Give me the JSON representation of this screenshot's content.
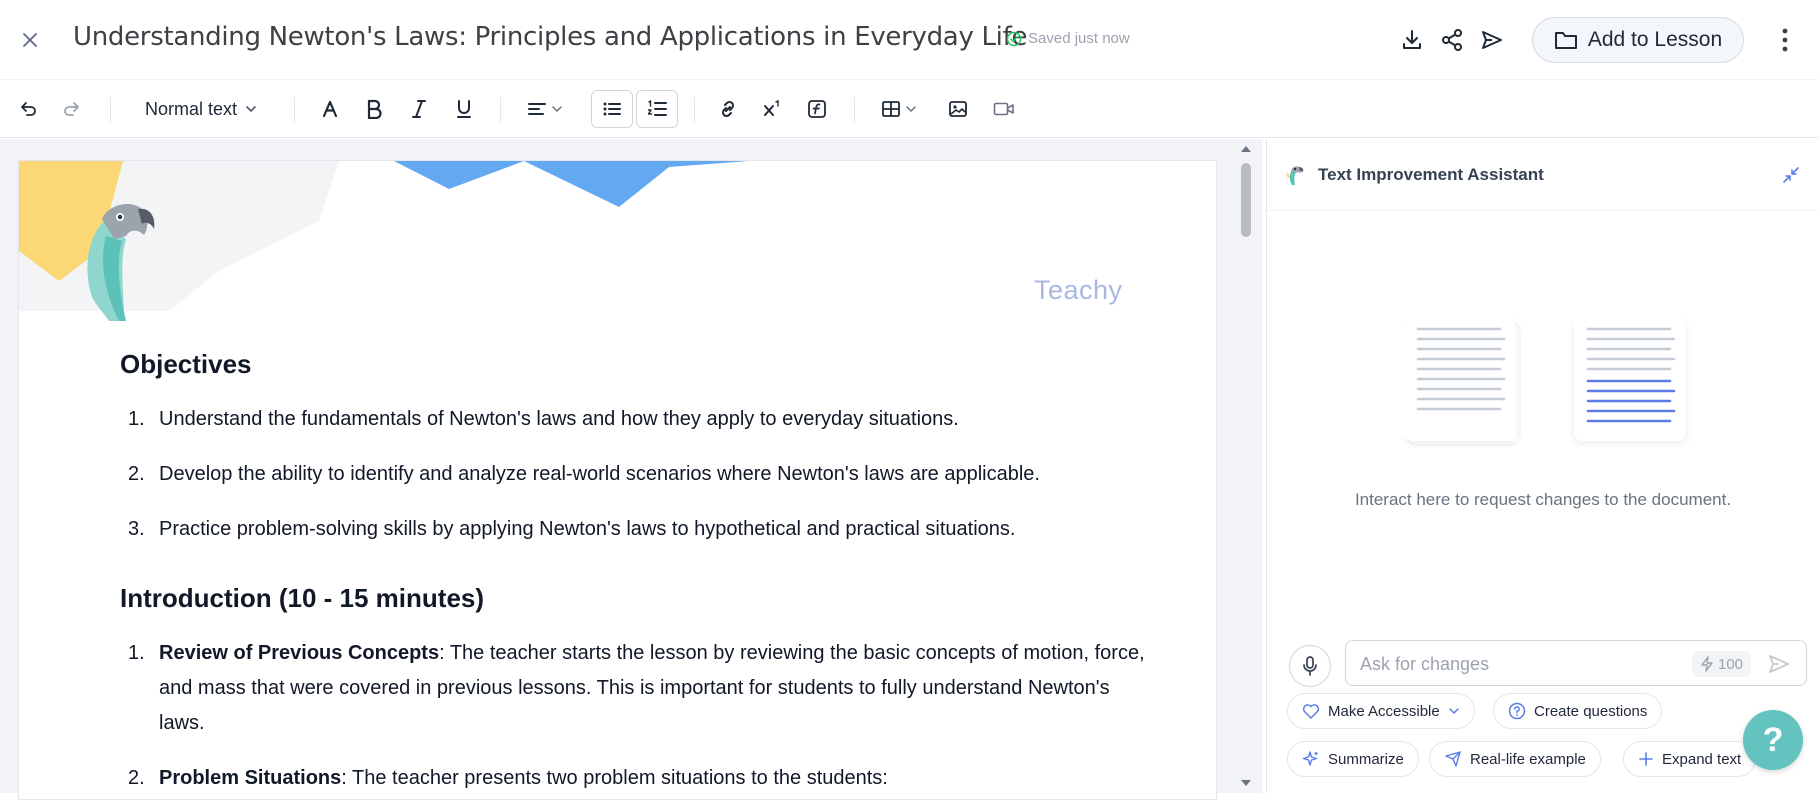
{
  "header": {
    "title": "Understanding Newton's Laws: Principles and Applications in Everyday Life",
    "saved_status": "Saved just now",
    "add_to_lesson_label": "Add to Lesson"
  },
  "toolbar": {
    "text_style": "Normal text"
  },
  "document": {
    "brand": "Teachy",
    "sections": [
      {
        "heading": "Objectives",
        "items": [
          {
            "num": "1.",
            "text": "Understand the fundamentals of Newton's laws and how they apply to everyday situations."
          },
          {
            "num": "2.",
            "text": "Develop the ability to identify and analyze real-world scenarios where Newton's laws are applicable."
          },
          {
            "num": "3.",
            "text": "Practice problem-solving skills by applying Newton's laws to hypothetical and practical situations."
          }
        ]
      },
      {
        "heading": "Introduction (10 - 15 minutes)",
        "items": [
          {
            "num": "1.",
            "bold": "Review of Previous Concepts",
            "text": ": The teacher starts the lesson by reviewing the basic concepts of motion, force, and mass that were covered in previous lessons. This is important for students to fully understand Newton's laws."
          },
          {
            "num": "2.",
            "bold": "Problem Situations",
            "text": ": The teacher presents two problem situations to the students:"
          }
        ]
      }
    ]
  },
  "assistant": {
    "title": "Text Improvement Assistant",
    "hint": "Interact here to request changes to the document.",
    "input_placeholder": "Ask for changes",
    "credits": "100",
    "chips": {
      "make_accessible": "Make Accessible",
      "create_questions": "Create questions",
      "summarize": "Summarize",
      "real_life_example": "Real-life example",
      "expand_text": "Expand text"
    }
  },
  "help": {
    "label": "?"
  },
  "colors": {
    "accent_teal": "#63c3be",
    "brand_blue": "#a9b8e2",
    "highlight_blue": "#5b7ce6",
    "saved_green": "#22c55e"
  }
}
